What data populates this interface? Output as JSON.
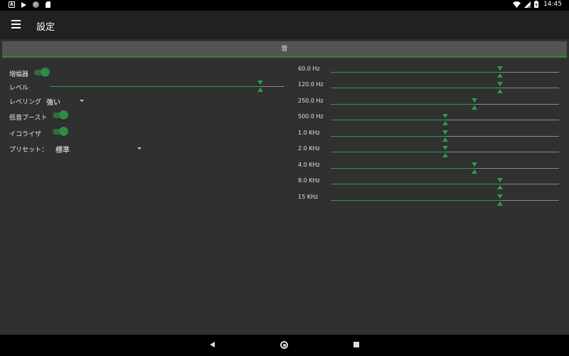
{
  "status_bar": {
    "time": "14:45",
    "icons": [
      "a-icon",
      "play-icon",
      "circle-icon",
      "sd-card-icon",
      "wifi-icon",
      "signal-icon",
      "battery-icon"
    ]
  },
  "app_bar": {
    "title": "設定",
    "menu_icon": "menu-icon"
  },
  "section": {
    "label": "音"
  },
  "settings": {
    "amplifier": {
      "label": "増幅器",
      "enabled": true
    },
    "level": {
      "label": "レベル",
      "value_fraction": 0.9
    },
    "leveling": {
      "label": "レベリング",
      "selected": "強い"
    },
    "bass_boost": {
      "label": "低音ブースト",
      "enabled": true
    },
    "equalizer": {
      "label": "イコライザ",
      "enabled": true
    },
    "preset": {
      "label": "プリセット：",
      "selected": "標準"
    }
  },
  "equalizer_bands": [
    {
      "label": "60.0 Hz",
      "value_fraction": 0.74
    },
    {
      "label": "120.0 Hz",
      "value_fraction": 0.74
    },
    {
      "label": "250.0 Hz",
      "value_fraction": 0.63
    },
    {
      "label": "500.0 Hz",
      "value_fraction": 0.5
    },
    {
      "label": "1.0 KHz",
      "value_fraction": 0.5
    },
    {
      "label": "2.0 KHz",
      "value_fraction": 0.5
    },
    {
      "label": "4.0 KHz",
      "value_fraction": 0.63
    },
    {
      "label": "8.0 KHz",
      "value_fraction": 0.74
    },
    {
      "label": "15 KHz",
      "value_fraction": 0.74
    }
  ],
  "colors": {
    "accent": "#2e9d42",
    "background": "#303030",
    "app_bar": "#212121",
    "section_header": "#545454"
  }
}
